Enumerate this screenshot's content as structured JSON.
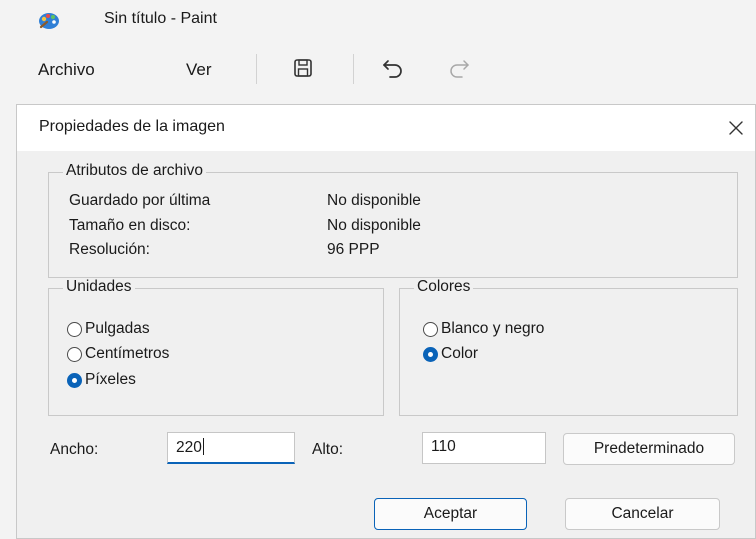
{
  "window": {
    "title": "Sin título - Paint",
    "icon": "paint-palette-icon"
  },
  "menubar": {
    "items": [
      "Archivo",
      "Ver"
    ],
    "tools": [
      "save-icon",
      "undo-icon",
      "redo-icon"
    ]
  },
  "dialog": {
    "title": "Propiedades de la imagen",
    "close_icon": "close-icon",
    "attributes": {
      "legend": "Atributos de archivo",
      "rows": [
        {
          "label": "Guardado por última",
          "value": "No disponible"
        },
        {
          "label": "Tamaño en disco:",
          "value": "No disponible"
        },
        {
          "label": "Resolución:",
          "value": "96 PPP"
        }
      ]
    },
    "units": {
      "legend": "Unidades",
      "options": [
        "Pulgadas",
        "Centímetros",
        "Píxeles"
      ],
      "selected": "Píxeles"
    },
    "colors": {
      "legend": "Colores",
      "options": [
        "Blanco y negro",
        "Color"
      ],
      "selected": "Color"
    },
    "size": {
      "width_label": "Ancho:",
      "width_value": "220",
      "height_label": "Alto:",
      "height_value": "110"
    },
    "buttons": {
      "default": "Predeterminado",
      "ok": "Aceptar",
      "cancel": "Cancelar"
    },
    "accent_color": "#0a63b8"
  }
}
